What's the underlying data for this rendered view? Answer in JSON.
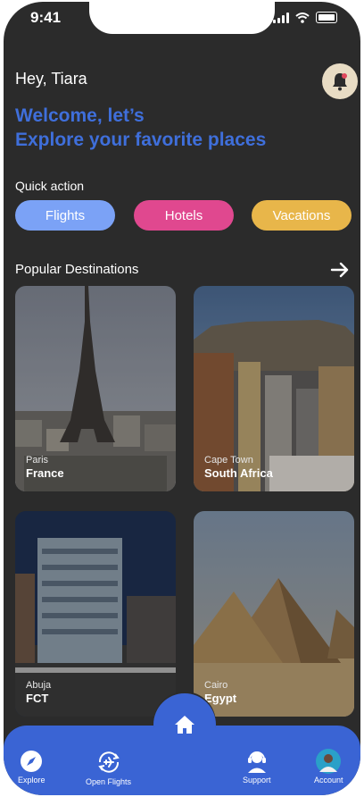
{
  "status_bar": {
    "time": "9:41"
  },
  "header": {
    "greeting": "Hey, Tiara",
    "welcome_line1": "Welcome, let’s",
    "welcome_line2": "Explore your favorite places"
  },
  "quick_action": {
    "label": "Quick action",
    "buttons": [
      {
        "label": "Flights",
        "color": "#7ba2f6"
      },
      {
        "label": "Hotels",
        "color": "#e0488f"
      },
      {
        "label": "Vacations",
        "color": "#e8b64a"
      }
    ]
  },
  "popular": {
    "title": "Popular Destinations",
    "cards": [
      {
        "city": "Paris",
        "country": "France",
        "icon": "eiffel-tower"
      },
      {
        "city": "Cape Town",
        "country": "South Africa",
        "icon": "table-mountain"
      },
      {
        "city": "Abuja",
        "country": "FCT",
        "icon": "office-tower"
      },
      {
        "city": "Cairo",
        "country": "Egypt",
        "icon": "pyramids"
      }
    ]
  },
  "nav": {
    "items": [
      {
        "label": "Explore",
        "icon": "compass-icon"
      },
      {
        "label": "Open Flights",
        "icon": "plane-refresh-icon"
      },
      {
        "label": "Support",
        "icon": "headset-icon"
      },
      {
        "label": "Account",
        "icon": "avatar"
      }
    ],
    "home_icon": "home-icon"
  },
  "colors": {
    "background": "#2b2b2b",
    "accent": "#3a64d4",
    "welcome_text": "#3f6fdb"
  }
}
